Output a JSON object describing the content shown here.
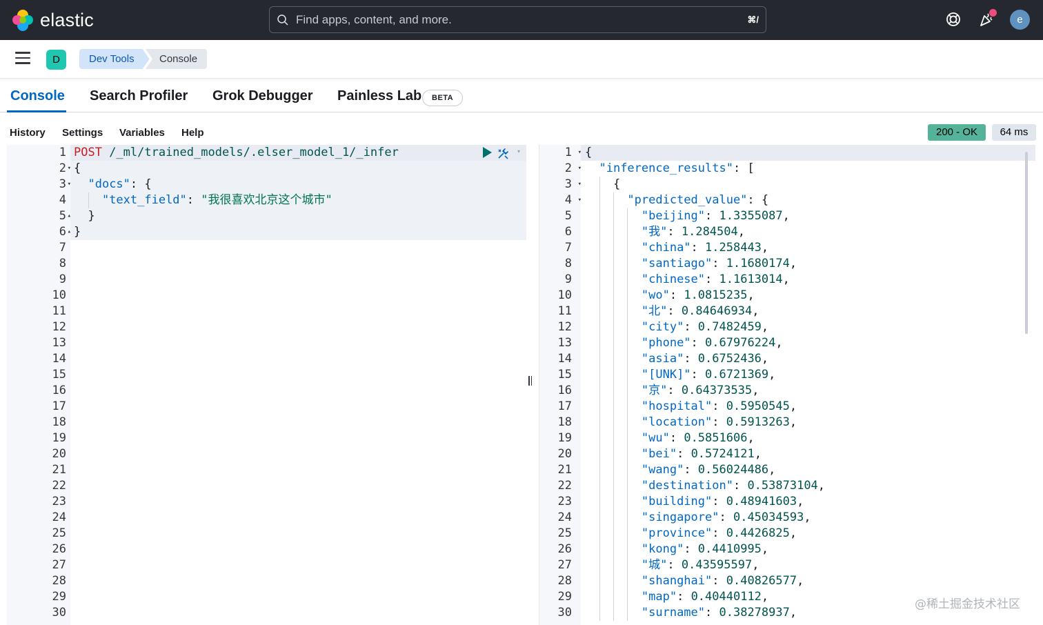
{
  "header": {
    "brand": "elastic",
    "search_placeholder": "Find apps, content, and more.",
    "search_shortcut": "⌘/",
    "user_initial": "e"
  },
  "breadcrumbs": {
    "space_initial": "D",
    "items": [
      "Dev Tools",
      "Console"
    ]
  },
  "tabs": {
    "items": [
      "Console",
      "Search Profiler",
      "Grok Debugger",
      "Painless Lab"
    ],
    "active": "Console",
    "beta_badge": "BETA"
  },
  "console_menu": {
    "items": [
      "History",
      "Settings",
      "Variables",
      "Help"
    ],
    "status": "200 - OK",
    "duration": "64 ms"
  },
  "request": {
    "method": "POST",
    "path": " /_ml/trained_models/.elser_model_1/_infer",
    "docs_key": "\"docs\"",
    "field_key": "\"text_field\"",
    "field_value": "\"我很喜欢北京这个城市\"",
    "line_count": 30
  },
  "response": {
    "root_key": "\"inference_results\"",
    "predicted_key": "\"predicted_value\"",
    "tokens": [
      {
        "k": "\"beijing\"",
        "v": "1.3355087"
      },
      {
        "k": "\"我\"",
        "v": "1.284504"
      },
      {
        "k": "\"china\"",
        "v": "1.258443"
      },
      {
        "k": "\"santiago\"",
        "v": "1.1680174"
      },
      {
        "k": "\"chinese\"",
        "v": "1.1613014"
      },
      {
        "k": "\"wo\"",
        "v": "1.0815235"
      },
      {
        "k": "\"北\"",
        "v": "0.84646934"
      },
      {
        "k": "\"city\"",
        "v": "0.7482459"
      },
      {
        "k": "\"phone\"",
        "v": "0.67976224"
      },
      {
        "k": "\"asia\"",
        "v": "0.6752436"
      },
      {
        "k": "\"[UNK]\"",
        "v": "0.6721369"
      },
      {
        "k": "\"京\"",
        "v": "0.64373535"
      },
      {
        "k": "\"hospital\"",
        "v": "0.5950545"
      },
      {
        "k": "\"location\"",
        "v": "0.5913263"
      },
      {
        "k": "\"wu\"",
        "v": "0.5851606"
      },
      {
        "k": "\"bei\"",
        "v": "0.5724121"
      },
      {
        "k": "\"wang\"",
        "v": "0.56024486"
      },
      {
        "k": "\"destination\"",
        "v": "0.53873104"
      },
      {
        "k": "\"building\"",
        "v": "0.48941603"
      },
      {
        "k": "\"singapore\"",
        "v": "0.45034593"
      },
      {
        "k": "\"province\"",
        "v": "0.4426825"
      },
      {
        "k": "\"kong\"",
        "v": "0.4410995"
      },
      {
        "k": "\"城\"",
        "v": "0.43595597"
      },
      {
        "k": "\"shanghai\"",
        "v": "0.40826577"
      },
      {
        "k": "\"map\"",
        "v": "0.40440112"
      },
      {
        "k": "\"surname\"",
        "v": "0.38278937"
      }
    ]
  },
  "watermark": "@稀土掘金技术社区",
  "colors": {
    "header_bg": "#25282f",
    "accent": "#0067c5",
    "status_ok": "#54b399"
  }
}
